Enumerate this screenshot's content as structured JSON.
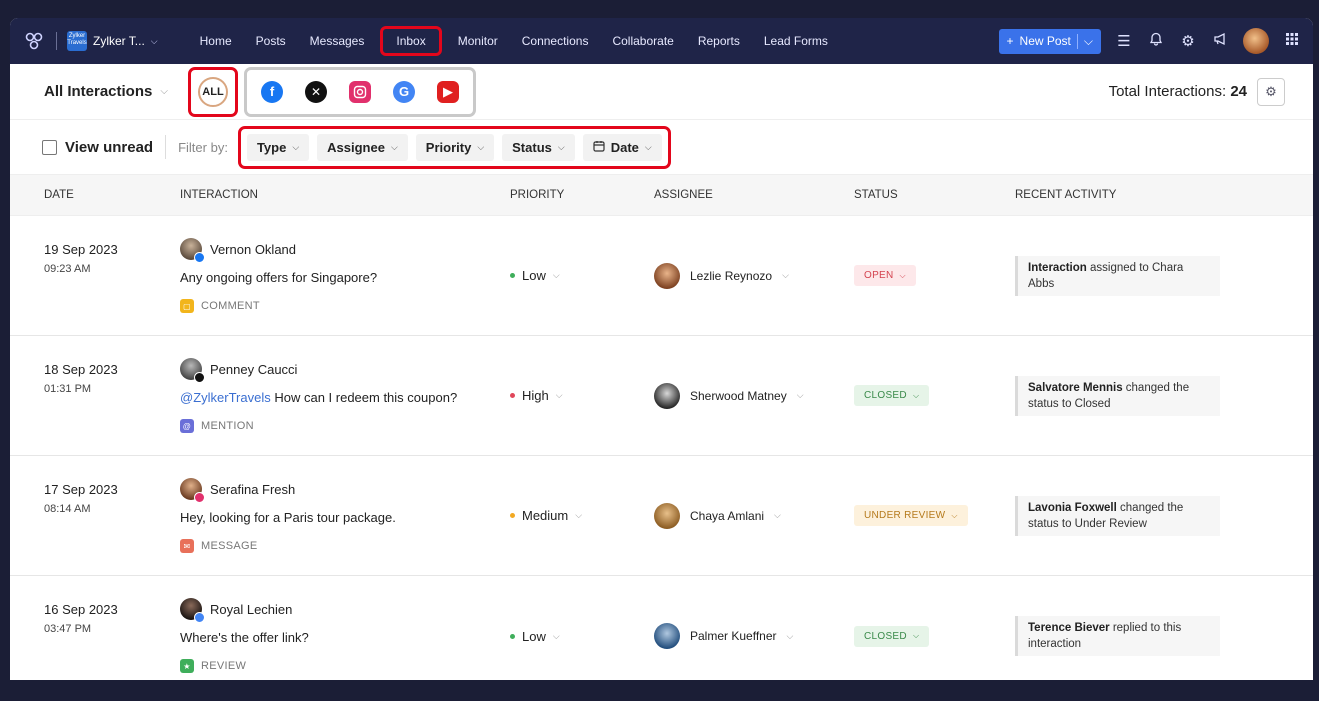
{
  "nav": {
    "brand": "Zylker T...",
    "brand_chip": "Zylker Travels",
    "items": [
      "Home",
      "Posts",
      "Messages",
      "Inbox",
      "Monitor",
      "Connections",
      "Collaborate",
      "Reports",
      "Lead Forms"
    ],
    "active": "Inbox",
    "new_post": "New Post"
  },
  "header": {
    "view": "All Interactions",
    "all_label": "ALL",
    "total_label": "Total Interactions:",
    "total_count": "24"
  },
  "filters": {
    "view_unread": "View unread",
    "filter_by": "Filter by:",
    "type": "Type",
    "assignee": "Assignee",
    "priority": "Priority",
    "status": "Status",
    "date": "Date"
  },
  "columns": {
    "date": "DATE",
    "interaction": "INTERACTION",
    "priority": "PRIORITY",
    "assignee": "ASSIGNEE",
    "status": "STATUS",
    "recent": "RECENT ACTIVITY"
  },
  "rows": [
    {
      "date": "19 Sep 2023",
      "time": "09:23 AM",
      "name": "Vernon Okland",
      "mention": "",
      "message": "Any ongoing offers for Singapore?",
      "kind": "COMMENT",
      "priority": "Low",
      "assignee": "Lezlie Reynozo",
      "status": "OPEN",
      "recent_bold": "Interaction",
      "recent_rest": " assigned to Chara Abbs"
    },
    {
      "date": "18 Sep 2023",
      "time": "01:31 PM",
      "name": "Penney Caucci",
      "mention": "@ZylkerTravels",
      "message": " How can I redeem this coupon?",
      "kind": "MENTION",
      "priority": "High",
      "assignee": "Sherwood Matney",
      "status": "CLOSED",
      "recent_bold": "Salvatore Mennis",
      "recent_rest": " changed the status to Closed"
    },
    {
      "date": "17 Sep 2023",
      "time": "08:14 AM",
      "name": "Serafina Fresh",
      "mention": "",
      "message": "Hey, looking for a Paris tour package.",
      "kind": "MESSAGE",
      "priority": "Medium",
      "assignee": "Chaya Amlani",
      "status": "UNDER REVIEW",
      "recent_bold": "Lavonia Foxwell",
      "recent_rest": " changed the status to Under Review"
    },
    {
      "date": "16 Sep 2023",
      "time": "03:47 PM",
      "name": "Royal Lechien",
      "mention": "",
      "message": "Where's the offer link?",
      "kind": "REVIEW",
      "priority": "Low",
      "assignee": "Palmer Kueffner",
      "status": "CLOSED",
      "recent_bold": "Terence Biever",
      "recent_rest": " replied to this interaction"
    }
  ],
  "colors": {
    "highlight": "#e3061b",
    "nav_bg": "#1f2448",
    "facebook": "#1877f2",
    "x": "#111111",
    "instagram": "#e1306c",
    "google": "#4285f4",
    "youtube": "#e02020",
    "low": "#3fae5b",
    "high": "#e0475a",
    "medium": "#f2a922"
  }
}
